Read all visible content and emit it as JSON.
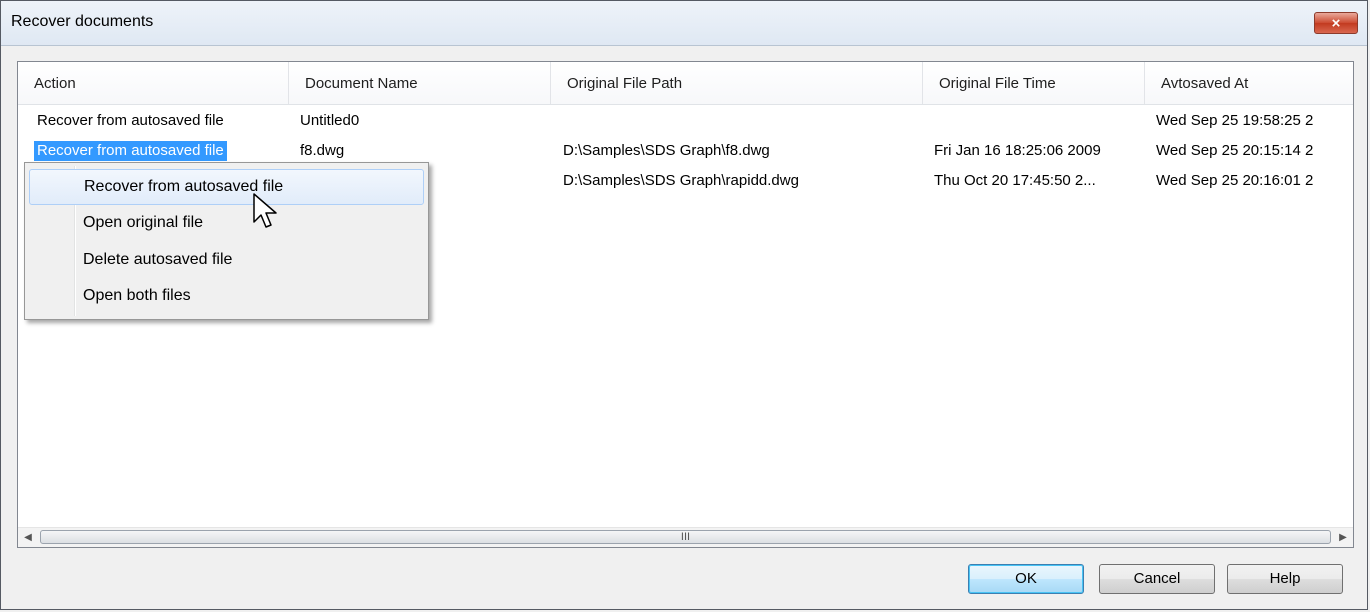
{
  "window": {
    "title": "Recover documents",
    "close_icon": "×"
  },
  "list": {
    "columns": [
      "Action",
      "Document Name",
      "Original  File Path",
      "Original File Time",
      "Avtosaved At"
    ],
    "rows": [
      {
        "action": "Recover from autosaved file",
        "document_name": "Untitled0",
        "path": "",
        "file_time": "",
        "autosaved_at": "Wed Sep 25 19:58:25 2",
        "selected": false
      },
      {
        "action": "Recover from autosaved file",
        "document_name": "f8.dwg",
        "path": "D:\\Samples\\SDS Graph\\f8.dwg",
        "file_time": "Fri Jan 16 18:25:06 2009",
        "autosaved_at": "Wed Sep 25 20:15:14 2",
        "selected": true
      },
      {
        "action": "",
        "document_name": "",
        "path": "D:\\Samples\\SDS Graph\\rapidd.dwg",
        "file_time": "Thu Oct 20 17:45:50 2...",
        "autosaved_at": "Wed Sep 25 20:16:01 2",
        "selected": false
      }
    ]
  },
  "scrollbar": {
    "left_arrow": "◀",
    "right_arrow": "▶",
    "grip": "III"
  },
  "context_menu": {
    "items": [
      "Recover from autosaved file",
      "Open original file",
      "Delete autosaved file",
      "Open both files"
    ],
    "highlighted_item": "Recover from autosaved file"
  },
  "buttons": {
    "ok": "OK",
    "cancel": "Cancel",
    "help": "Help"
  },
  "colors": {
    "selection": "#3399ff",
    "menu_highlight_border": "#aecff7",
    "close_button": "#c7402a"
  }
}
